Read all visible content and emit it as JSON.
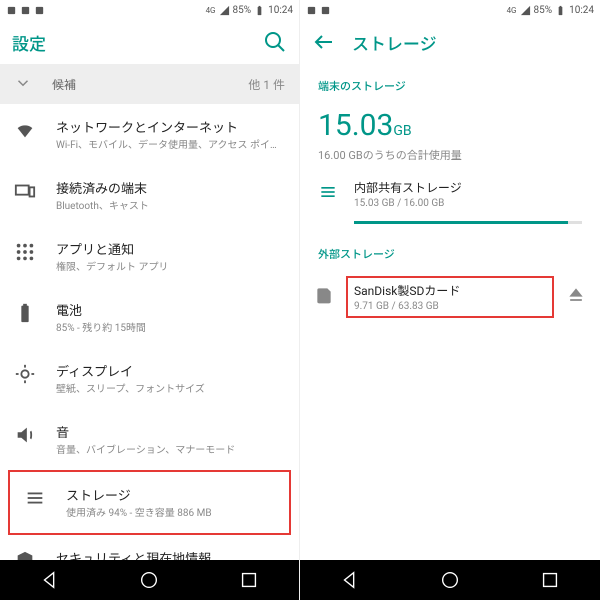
{
  "statusbar": {
    "battery_pct": "85%",
    "time": "10:24",
    "net": "4G"
  },
  "left": {
    "title": "設定",
    "suggest": {
      "label": "候補",
      "more": "他 1 件"
    },
    "rows": [
      {
        "icon": "wifi",
        "title": "ネットワークとインターネット",
        "sub": "Wi-Fi、モバイル、データ使用量、アクセス ポイ…"
      },
      {
        "icon": "devices",
        "title": "接続済みの端末",
        "sub": "Bluetooth、キャスト"
      },
      {
        "icon": "apps",
        "title": "アプリと通知",
        "sub": "権限、デフォルト アプリ"
      },
      {
        "icon": "battery",
        "title": "電池",
        "sub": "85% - 残り約 15時間"
      },
      {
        "icon": "display",
        "title": "ディスプレイ",
        "sub": "壁紙、スリープ、フォントサイズ"
      },
      {
        "icon": "sound",
        "title": "音",
        "sub": "音量、バイブレーション、マナーモード"
      },
      {
        "icon": "storage",
        "title": "ストレージ",
        "sub": "使用済み 94% - 空き容量 886 MB",
        "hl": true
      },
      {
        "icon": "security",
        "title": "セキュリティと現在地情報",
        "sub": ""
      }
    ]
  },
  "right": {
    "title": "ストレージ",
    "section_device": "端末のストレージ",
    "big_num": "15.03",
    "big_unit": "GB",
    "big_sub": "16.00 GBのうちの合計使用量",
    "internal": {
      "title": "内部共有ストレージ",
      "sub": "15.03 GB / 16.00 GB"
    },
    "section_ext": "外部ストレージ",
    "ext": {
      "title": "SanDisk製SDカード",
      "sub": "9.71 GB / 63.83 GB"
    }
  }
}
